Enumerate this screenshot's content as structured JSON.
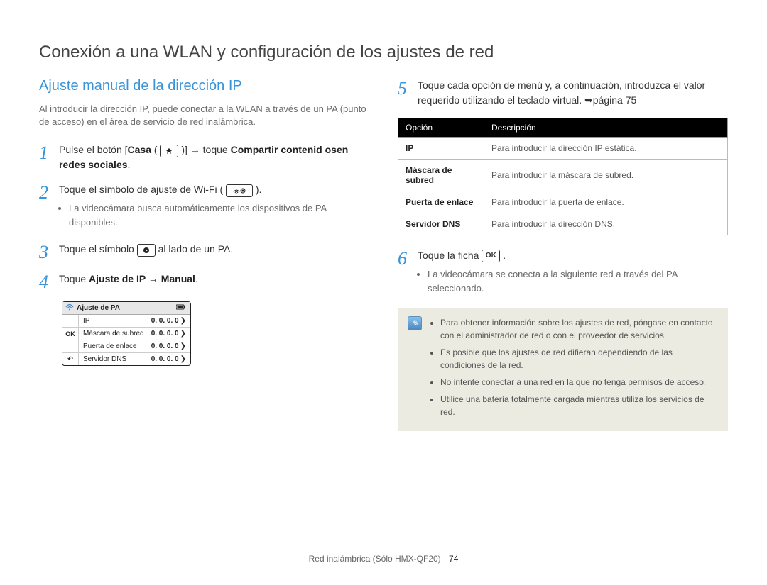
{
  "title": "Conexión a una WLAN y configuración de los ajustes de red",
  "left": {
    "heading": "Ajuste manual de la dirección IP",
    "intro": "Al introducir la dirección IP, puede conectar a la WLAN a través de un PA (punto de acceso) en el área de servicio de red inalámbrica.",
    "steps": {
      "s1_a": "Pulse el botón [",
      "s1_casa": "Casa",
      "s1_b": " ( ",
      "s1_c": " )] → toque ",
      "s1_share": "Compartir contenid osen redes sociales",
      "s1_d": ".",
      "s2": "Toque el símbolo de ajuste de Wi-Fi ( ",
      "s2b": " ).",
      "s2_sub": "La videocámara busca automáticamente los dispositivos de PA disponibles.",
      "s3a": "Toque el símbolo ",
      "s3b": " al lado de un PA.",
      "s4a": "Toque ",
      "s4_bold": "Ajuste de IP → Manual",
      "s4b": "."
    },
    "miniscreen": {
      "title": "Ajuste de PA",
      "ok": "OK",
      "back": "↶",
      "rows": [
        {
          "label": "IP",
          "value": "0. 0. 0. 0"
        },
        {
          "label": "Máscara de subred",
          "value": "0. 0. 0. 0"
        },
        {
          "label": "Puerta de enlace",
          "value": "0. 0. 0. 0"
        },
        {
          "label": "Servidor DNS",
          "value": "0. 0. 0. 0"
        }
      ]
    }
  },
  "right": {
    "s5": "Toque cada opción de menú y, a continuación, introduzca el valor requerido utilizando el teclado virtual. ➥página 75",
    "table": {
      "h1": "Opción",
      "h2": "Descripción",
      "rows": [
        {
          "opt": "IP",
          "desc": "Para introducir la dirección IP estática."
        },
        {
          "opt": "Máscara de subred",
          "desc": "Para introducir la máscara de subred."
        },
        {
          "opt": "Puerta de enlace",
          "desc": "Para introducir la puerta de enlace."
        },
        {
          "opt": "Servidor DNS",
          "desc": "Para introducir la dirección DNS."
        }
      ]
    },
    "s6a": "Toque la ficha ",
    "s6_ok": "OK",
    "s6b": " .",
    "s6_sub": "La videocámara se conecta a la siguiente red a través del PA seleccionado.",
    "notes": [
      "Para obtener información sobre los ajustes de red, póngase en contacto con el administrador de red o con el proveedor de servicios.",
      "Es posible que los ajustes de red difieran dependiendo de las condiciones de la red.",
      "No intente conectar a una red en la que no tenga permisos de acceso.",
      "Utilice una batería totalmente cargada mientras utiliza los servicios de red."
    ]
  },
  "footer": {
    "text": "Red inalámbrica (Sólo HMX-QF20)",
    "page": "74"
  }
}
